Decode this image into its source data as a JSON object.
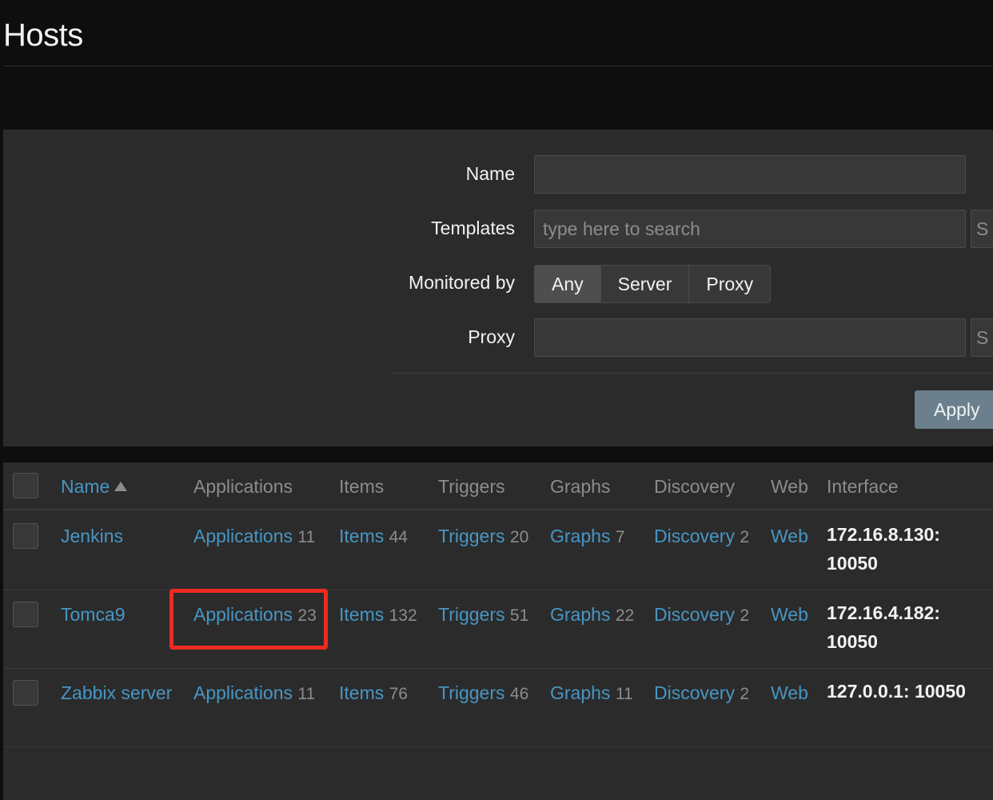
{
  "page": {
    "title": "Hosts"
  },
  "filter": {
    "name_label": "Name",
    "name_value": "",
    "templates_label": "Templates",
    "templates_placeholder": "type here to search",
    "templates_select": "S",
    "monitored_label": "Monitored by",
    "monitored_options": [
      "Any",
      "Server",
      "Proxy"
    ],
    "monitored_selected": "Any",
    "proxy_label": "Proxy",
    "proxy_value": "",
    "proxy_select": "S",
    "apply_label": "Apply"
  },
  "table": {
    "headers": {
      "name": "Name",
      "applications": "Applications",
      "items": "Items",
      "triggers": "Triggers",
      "graphs": "Graphs",
      "discovery": "Discovery",
      "web": "Web",
      "interface": "Interface"
    },
    "rows": [
      {
        "name": "Jenkins",
        "applications": "Applications",
        "applications_count": "11",
        "items": "Items",
        "items_count": "44",
        "triggers": "Triggers",
        "triggers_count": "20",
        "graphs": "Graphs",
        "graphs_count": "7",
        "discovery": "Discovery",
        "discovery_count": "2",
        "web": "Web",
        "interface": "172.16.8.130: 10050"
      },
      {
        "name": "Tomca9",
        "applications": "Applications",
        "applications_count": "23",
        "items": "Items",
        "items_count": "132",
        "triggers": "Triggers",
        "triggers_count": "51",
        "graphs": "Graphs",
        "graphs_count": "22",
        "discovery": "Discovery",
        "discovery_count": "2",
        "web": "Web",
        "interface": "172.16.4.182: 10050"
      },
      {
        "name": "Zabbix server",
        "applications": "Applications",
        "applications_count": "11",
        "items": "Items",
        "items_count": "76",
        "triggers": "Triggers",
        "triggers_count": "46",
        "graphs": "Graphs",
        "graphs_count": "11",
        "discovery": "Discovery",
        "discovery_count": "2",
        "web": "Web",
        "interface": "127.0.0.1: 10050"
      }
    ]
  },
  "colors": {
    "background": "#0e0e0e",
    "panel": "#2b2b2b",
    "link": "#4796c4",
    "highlight": "#ee2a22",
    "apply_button": "#6b7f8c"
  }
}
